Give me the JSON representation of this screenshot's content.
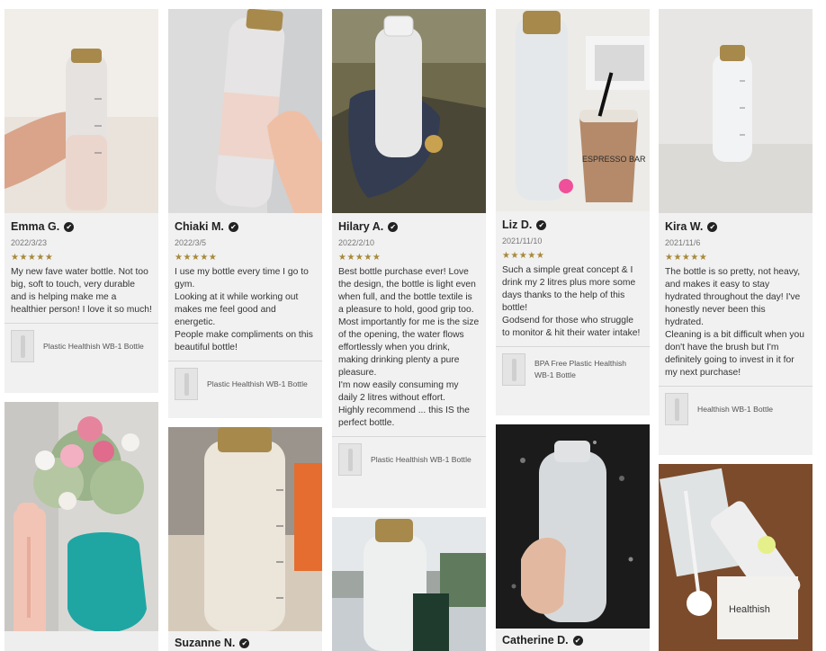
{
  "reviews": [
    {
      "name": "Emma G.",
      "date": "2022/3/23",
      "stars": "★★★★★",
      "text": "My new fave water bottle. Not too big, soft to touch, very durable and is helping make me a healthier person! I love it so much!",
      "product": "Plastic Healthish WB-1 Bottle"
    },
    {
      "name": "Chiaki M.",
      "date": "2022/3/5",
      "stars": "★★★★★",
      "text": "I use my bottle every time I go to gym.\nLooking at it while working out makes me feel good and energetic.\nPeople make compliments on this beautiful bottle!",
      "product": "Plastic Healthish WB-1 Bottle"
    },
    {
      "name": "Hilary A.",
      "date": "2022/2/10",
      "stars": "★★★★★",
      "text": "Best bottle purchase ever! Love the design, the bottle is light even when full, and the bottle textile is a pleasure to hold, good grip too.\nMost importantly for me is the size of the opening, the water flows effortlessly when you drink, making drinking plenty a pure pleasure.\nI'm now easily consuming my daily 2 litres without effort.\nHighly recommend ... this IS the perfect bottle.",
      "product": "Plastic Healthish WB-1 Bottle"
    },
    {
      "name": "Liz D.",
      "date": "2021/11/10",
      "stars": "★★★★★",
      "text": "Such a simple great concept & I drink my 2 litres plus more some days thanks to the help of this bottle!\nGodsend for those who struggle to monitor & hit their water intake!",
      "product": "BPA Free Plastic Healthish WB-1 Bottle"
    },
    {
      "name": "Kira W.",
      "date": "2021/11/6",
      "stars": "★★★★★",
      "text": "The bottle is so pretty, not heavy, and makes it easy to stay hydrated throughout the day! I've honestly never been this hydrated.\nCleaning is a bit difficult when you don't have the brush but I'm definitely going to invest in it for my next purchase!",
      "product": "Healthish WB-1 Bottle"
    },
    {
      "name": "Suzanne N."
    },
    {
      "name": "Catherine D."
    }
  ],
  "photo_text": {
    "cup_label": "ESPRESSO BAR",
    "box_label": "Healthish"
  },
  "icons": {
    "verified": "✔",
    "verified_icon_name": "check-circle-icon"
  },
  "colors": {
    "card_bg": "#f1f1f1",
    "star": "#a8893a",
    "text": "#333333"
  }
}
